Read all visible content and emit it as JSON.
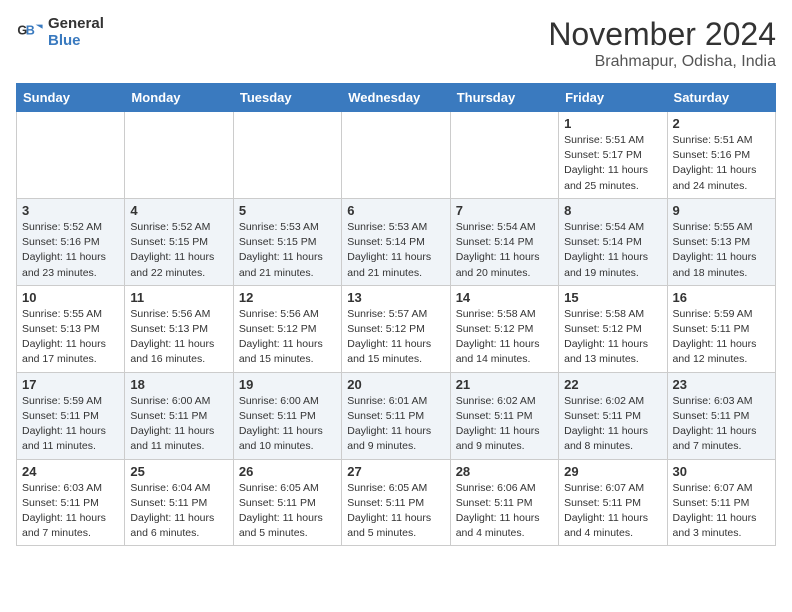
{
  "header": {
    "logo_line1": "General",
    "logo_line2": "Blue",
    "month_title": "November 2024",
    "location": "Brahmapur, Odisha, India"
  },
  "weekdays": [
    "Sunday",
    "Monday",
    "Tuesday",
    "Wednesday",
    "Thursday",
    "Friday",
    "Saturday"
  ],
  "weeks": [
    [
      {
        "day": "",
        "info": ""
      },
      {
        "day": "",
        "info": ""
      },
      {
        "day": "",
        "info": ""
      },
      {
        "day": "",
        "info": ""
      },
      {
        "day": "",
        "info": ""
      },
      {
        "day": "1",
        "info": "Sunrise: 5:51 AM\nSunset: 5:17 PM\nDaylight: 11 hours\nand 25 minutes."
      },
      {
        "day": "2",
        "info": "Sunrise: 5:51 AM\nSunset: 5:16 PM\nDaylight: 11 hours\nand 24 minutes."
      }
    ],
    [
      {
        "day": "3",
        "info": "Sunrise: 5:52 AM\nSunset: 5:16 PM\nDaylight: 11 hours\nand 23 minutes."
      },
      {
        "day": "4",
        "info": "Sunrise: 5:52 AM\nSunset: 5:15 PM\nDaylight: 11 hours\nand 22 minutes."
      },
      {
        "day": "5",
        "info": "Sunrise: 5:53 AM\nSunset: 5:15 PM\nDaylight: 11 hours\nand 21 minutes."
      },
      {
        "day": "6",
        "info": "Sunrise: 5:53 AM\nSunset: 5:14 PM\nDaylight: 11 hours\nand 21 minutes."
      },
      {
        "day": "7",
        "info": "Sunrise: 5:54 AM\nSunset: 5:14 PM\nDaylight: 11 hours\nand 20 minutes."
      },
      {
        "day": "8",
        "info": "Sunrise: 5:54 AM\nSunset: 5:14 PM\nDaylight: 11 hours\nand 19 minutes."
      },
      {
        "day": "9",
        "info": "Sunrise: 5:55 AM\nSunset: 5:13 PM\nDaylight: 11 hours\nand 18 minutes."
      }
    ],
    [
      {
        "day": "10",
        "info": "Sunrise: 5:55 AM\nSunset: 5:13 PM\nDaylight: 11 hours\nand 17 minutes."
      },
      {
        "day": "11",
        "info": "Sunrise: 5:56 AM\nSunset: 5:13 PM\nDaylight: 11 hours\nand 16 minutes."
      },
      {
        "day": "12",
        "info": "Sunrise: 5:56 AM\nSunset: 5:12 PM\nDaylight: 11 hours\nand 15 minutes."
      },
      {
        "day": "13",
        "info": "Sunrise: 5:57 AM\nSunset: 5:12 PM\nDaylight: 11 hours\nand 15 minutes."
      },
      {
        "day": "14",
        "info": "Sunrise: 5:58 AM\nSunset: 5:12 PM\nDaylight: 11 hours\nand 14 minutes."
      },
      {
        "day": "15",
        "info": "Sunrise: 5:58 AM\nSunset: 5:12 PM\nDaylight: 11 hours\nand 13 minutes."
      },
      {
        "day": "16",
        "info": "Sunrise: 5:59 AM\nSunset: 5:11 PM\nDaylight: 11 hours\nand 12 minutes."
      }
    ],
    [
      {
        "day": "17",
        "info": "Sunrise: 5:59 AM\nSunset: 5:11 PM\nDaylight: 11 hours\nand 11 minutes."
      },
      {
        "day": "18",
        "info": "Sunrise: 6:00 AM\nSunset: 5:11 PM\nDaylight: 11 hours\nand 11 minutes."
      },
      {
        "day": "19",
        "info": "Sunrise: 6:00 AM\nSunset: 5:11 PM\nDaylight: 11 hours\nand 10 minutes."
      },
      {
        "day": "20",
        "info": "Sunrise: 6:01 AM\nSunset: 5:11 PM\nDaylight: 11 hours\nand 9 minutes."
      },
      {
        "day": "21",
        "info": "Sunrise: 6:02 AM\nSunset: 5:11 PM\nDaylight: 11 hours\nand 9 minutes."
      },
      {
        "day": "22",
        "info": "Sunrise: 6:02 AM\nSunset: 5:11 PM\nDaylight: 11 hours\nand 8 minutes."
      },
      {
        "day": "23",
        "info": "Sunrise: 6:03 AM\nSunset: 5:11 PM\nDaylight: 11 hours\nand 7 minutes."
      }
    ],
    [
      {
        "day": "24",
        "info": "Sunrise: 6:03 AM\nSunset: 5:11 PM\nDaylight: 11 hours\nand 7 minutes."
      },
      {
        "day": "25",
        "info": "Sunrise: 6:04 AM\nSunset: 5:11 PM\nDaylight: 11 hours\nand 6 minutes."
      },
      {
        "day": "26",
        "info": "Sunrise: 6:05 AM\nSunset: 5:11 PM\nDaylight: 11 hours\nand 5 minutes."
      },
      {
        "day": "27",
        "info": "Sunrise: 6:05 AM\nSunset: 5:11 PM\nDaylight: 11 hours\nand 5 minutes."
      },
      {
        "day": "28",
        "info": "Sunrise: 6:06 AM\nSunset: 5:11 PM\nDaylight: 11 hours\nand 4 minutes."
      },
      {
        "day": "29",
        "info": "Sunrise: 6:07 AM\nSunset: 5:11 PM\nDaylight: 11 hours\nand 4 minutes."
      },
      {
        "day": "30",
        "info": "Sunrise: 6:07 AM\nSunset: 5:11 PM\nDaylight: 11 hours\nand 3 minutes."
      }
    ]
  ]
}
